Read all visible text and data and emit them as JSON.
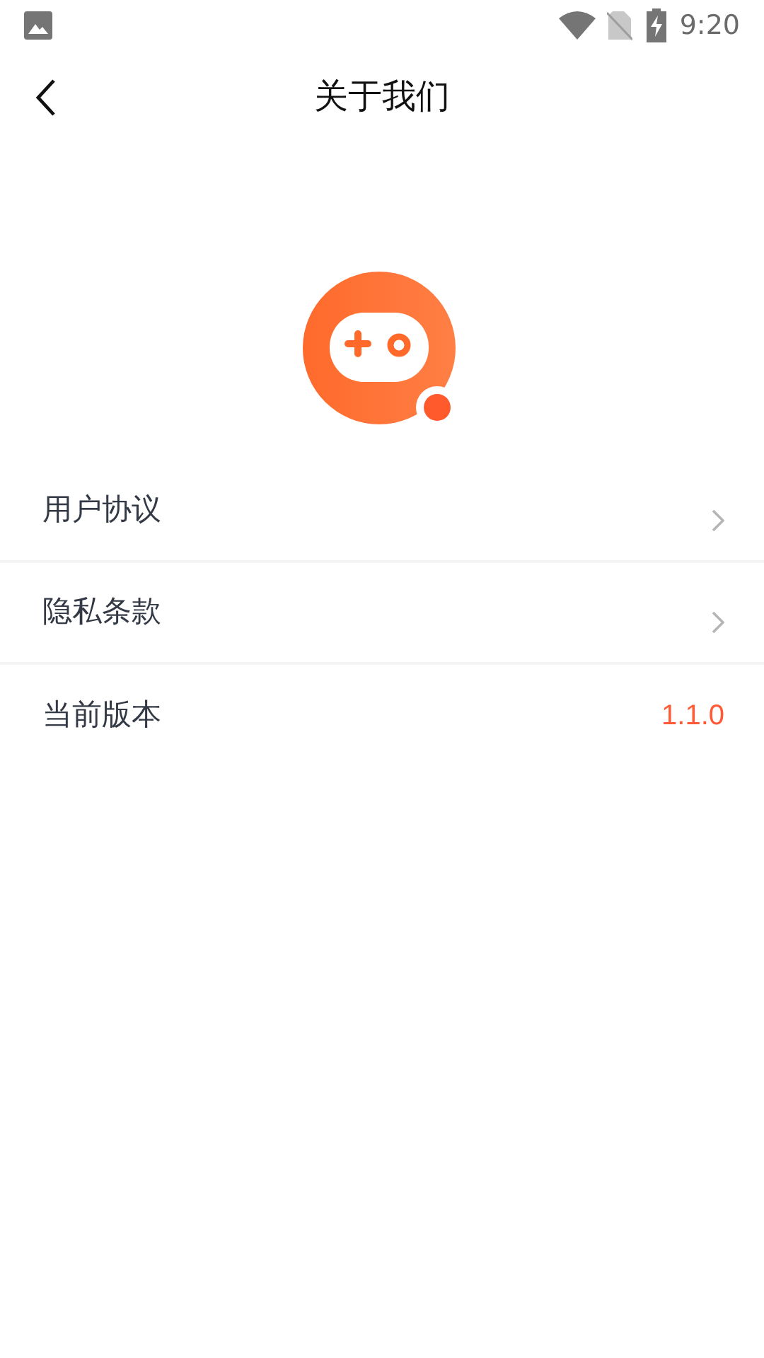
{
  "status_bar": {
    "time": "9:20"
  },
  "header": {
    "title": "关于我们"
  },
  "rows": [
    {
      "kind": "link",
      "label": "用户协议"
    },
    {
      "kind": "link",
      "label": "隐私条款"
    },
    {
      "kind": "value",
      "label": "当前版本",
      "value": "1.1.0"
    }
  ]
}
